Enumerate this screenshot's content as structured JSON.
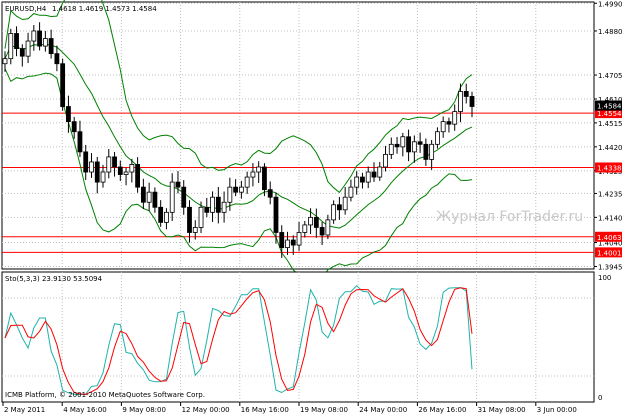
{
  "header": {
    "symbol_info": "EURUSD,H4",
    "ohlc": "1.4618 1.4619 1.4573 1.4584"
  },
  "watermark": "Журнал ForTrader.ru",
  "copyright": "ICMB Platform, © 2001-2010 MetaQuotes Software Corp.",
  "oscillator": {
    "label": "Sto(5,3,3) 23.9130 53.5094",
    "upper_label": "100",
    "lower_label": "0"
  },
  "colors": {
    "background": "#ffffff",
    "grid": "#c0c0c0",
    "candle": "#000000",
    "bollinger": "#008000",
    "level_line": "#ff0000",
    "price_badge_bg": "#ff0000",
    "price_badge_text": "#ffffff",
    "current_price_bg": "#000000",
    "stoch_main": "#20b2aa",
    "stoch_signal": "#ff0000"
  },
  "chart_data": {
    "type": "candlestick",
    "symbol": "EURUSD",
    "timeframe": "H4",
    "y_axis_ticks": [
      "1.4990",
      "1.4880",
      "1.4705",
      "1.4610",
      "1.4515",
      "1.4420",
      "1.4325",
      "1.4235",
      "1.4140",
      "1.4040",
      "1.3945"
    ],
    "ylim": [
      1.3935,
      1.4995
    ],
    "x_axis_ticks": [
      "2 May 2011",
      "4 May 16:00",
      "9 May 08:00",
      "12 May 00:00",
      "16 May 16:00",
      "19 May 08:00",
      "24 May 00:00",
      "26 May 16:00",
      "31 May 08:00",
      "3 Jun 00:00"
    ],
    "current_price": "1.4584",
    "levels": [
      "1.4554",
      "1.4338",
      "1.4063",
      "1.4001"
    ],
    "level_values": [
      1.4554,
      1.4338,
      1.4063,
      1.4001
    ],
    "price_path": [
      1.477,
      1.487,
      1.481,
      1.478,
      1.484,
      1.488,
      1.482,
      1.485,
      1.479,
      1.475,
      1.458,
      1.452,
      1.448,
      1.44,
      1.432,
      1.436,
      1.428,
      1.432,
      1.438,
      1.434,
      1.431,
      1.432,
      1.435,
      1.426,
      1.42,
      1.424,
      1.418,
      1.412,
      1.416,
      1.428,
      1.426,
      1.418,
      1.408,
      1.41,
      1.418,
      1.416,
      1.422,
      1.416,
      1.42,
      1.426,
      1.424,
      1.426,
      1.43,
      1.432,
      1.434,
      1.425,
      1.422,
      1.408,
      1.402,
      1.405,
      1.403,
      1.408,
      1.411,
      1.414,
      1.41,
      1.407,
      1.413,
      1.419,
      1.417,
      1.422,
      1.426,
      1.43,
      1.428,
      1.432,
      1.43,
      1.434,
      1.439,
      1.443,
      1.442,
      1.446,
      1.44,
      1.444,
      1.443,
      1.437,
      1.443,
      1.448,
      1.452,
      1.451,
      1.456,
      1.464,
      1.462,
      1.458
    ],
    "stochastic": {
      "name": "Sto(5,3,3)",
      "main": 23.913,
      "signal": 53.5094,
      "ylim": [
        0,
        100
      ]
    }
  }
}
